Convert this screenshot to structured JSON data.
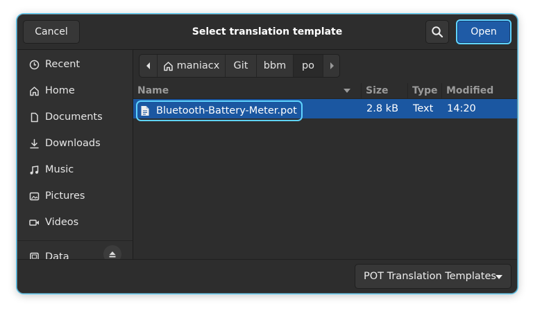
{
  "header": {
    "title": "Select translation template",
    "cancel_label": "Cancel",
    "open_label": "Open"
  },
  "sidebar": {
    "items": [
      {
        "label": "Recent",
        "icon": "clock-icon"
      },
      {
        "label": "Home",
        "icon": "home-icon"
      },
      {
        "label": "Documents",
        "icon": "document-icon"
      },
      {
        "label": "Downloads",
        "icon": "download-icon"
      },
      {
        "label": "Music",
        "icon": "music-icon"
      },
      {
        "label": "Pictures",
        "icon": "image-icon"
      },
      {
        "label": "Videos",
        "icon": "video-icon"
      }
    ],
    "drive": {
      "label": "Data",
      "icon": "drive-icon"
    }
  },
  "pathbar": {
    "segments": [
      "maniacx",
      "Git",
      "bbm",
      "po"
    ],
    "active_segment": "po"
  },
  "file_list": {
    "columns": [
      "Name",
      "Size",
      "Type",
      "Modified"
    ],
    "rows": [
      {
        "name": "Bluetooth-Battery-Meter.pot",
        "size": "2.8 kB",
        "type": "Text",
        "modified": "14:20",
        "selected": true
      }
    ]
  },
  "footer": {
    "filter_label": "POT Translation Templates"
  },
  "colors": {
    "accent": "#1b57a1",
    "focus_ring": "#5fd4ff",
    "background": "#2b2b2b"
  }
}
